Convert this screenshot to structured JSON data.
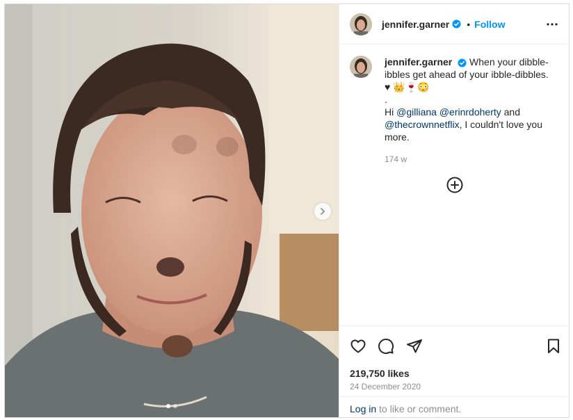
{
  "post": {
    "username": "jennifer.garner",
    "verified": true,
    "separator": "•",
    "follow_label": "Follow",
    "more_icon": "more-options-icon",
    "caption": {
      "text_1": "When your dibble-ibbles get ahead of your ibble-dibbles. ♥",
      "emojis": "👑🍷😳",
      "dot_line": ".",
      "hi": "Hi",
      "mention_1": "@gilliana",
      "mention_2": "@erinrdoherty",
      "and": "and",
      "mention_3": "@thecrownnetflix",
      "text_2": ", I couldn't love you more."
    },
    "time_ago": "174 w",
    "likes": "219,750 likes",
    "date": "24 December 2020",
    "login_link": "Log in",
    "login_rest": "to like or comment.",
    "carousel": {
      "slides": 2,
      "active": 0
    },
    "icons": [
      "heart-icon",
      "comment-icon",
      "share-icon",
      "bookmark-icon",
      "add-circle-icon",
      "chevron-right-icon"
    ],
    "colors": {
      "link": "#0095f6",
      "mention": "#00376b",
      "muted": "#8e8e8e",
      "border": "#dbdbdb"
    }
  }
}
